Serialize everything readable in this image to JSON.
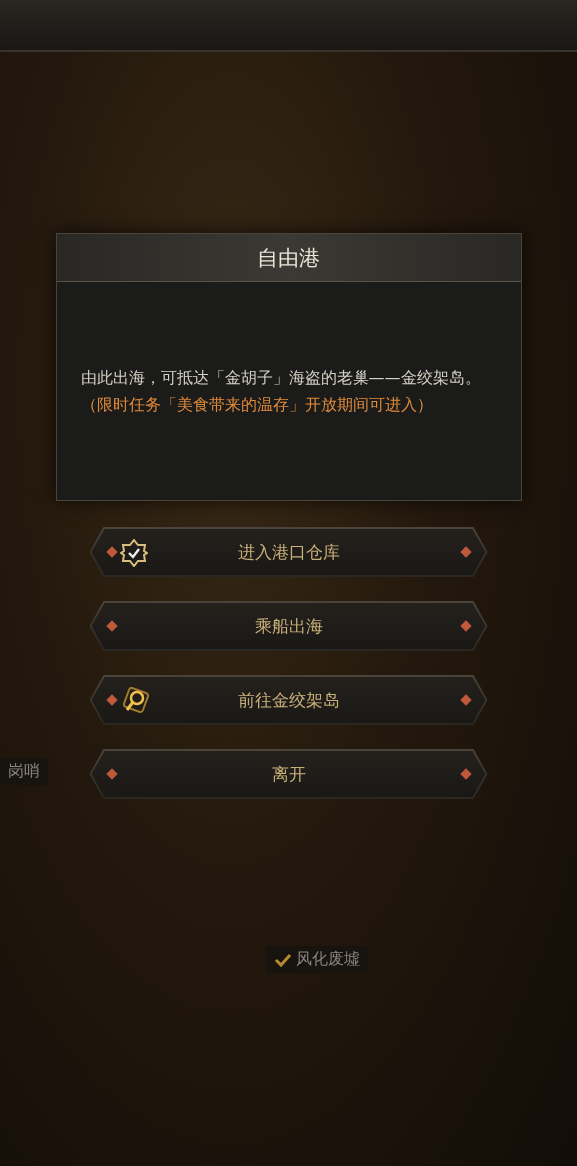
{
  "map_labels": [
    {
      "label": "岗哨",
      "checked": false
    },
    {
      "label": "风化废墟",
      "checked": true
    }
  ],
  "dialog": {
    "title": "自由港",
    "text": "由此出海，可抵达「金胡子」海盗的老巢——金绞架岛。",
    "note": "（限时任务「美食带来的温存」开放期间可进入）"
  },
  "buttons": [
    {
      "label": "进入港口仓库",
      "kind": "with_icon"
    },
    {
      "label": "乘船出海",
      "kind": "plain"
    },
    {
      "label": "前往金绞架岛",
      "kind": "with_icon"
    },
    {
      "label": "离开",
      "kind": "plain"
    }
  ]
}
